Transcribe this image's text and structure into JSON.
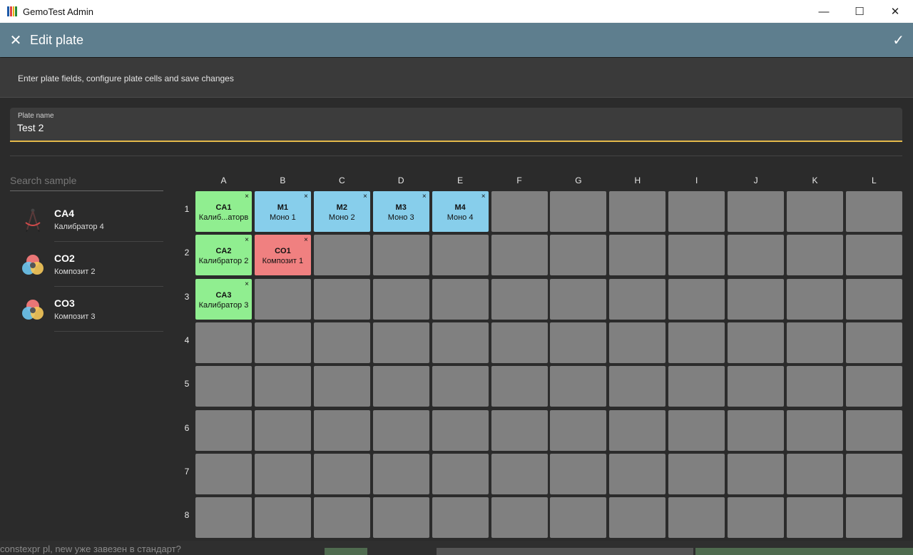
{
  "window": {
    "title": "GemoTest Admin"
  },
  "appbar": {
    "title": "Edit plate"
  },
  "subheader": {
    "description": "Enter plate fields, configure plate cells and save changes"
  },
  "plate_name": {
    "label": "Plate name",
    "value": "Test 2"
  },
  "search": {
    "placeholder": "Search sample"
  },
  "samples": [
    {
      "code": "CA4",
      "name": "Калибратор 4",
      "icon": "calibrator-compass-icon"
    },
    {
      "code": "CO2",
      "name": "Композит 2",
      "icon": "composite-venn-icon"
    },
    {
      "code": "CO3",
      "name": "Композит 3",
      "icon": "composite-venn-icon"
    }
  ],
  "grid": {
    "columns": [
      "A",
      "B",
      "C",
      "D",
      "E",
      "F",
      "G",
      "H",
      "I",
      "J",
      "K",
      "L"
    ],
    "rows": [
      "1",
      "2",
      "3",
      "4",
      "5",
      "6",
      "7",
      "8"
    ],
    "filled": [
      {
        "row": 0,
        "col": 0,
        "code": "CA1",
        "name": "Калиб...аторв",
        "color": "#90ee90"
      },
      {
        "row": 0,
        "col": 1,
        "code": "M1",
        "name": "Моно 1",
        "color": "#87ceeb"
      },
      {
        "row": 0,
        "col": 2,
        "code": "M2",
        "name": "Моно 2",
        "color": "#87ceeb"
      },
      {
        "row": 0,
        "col": 3,
        "code": "M3",
        "name": "Моно 3",
        "color": "#87ceeb"
      },
      {
        "row": 0,
        "col": 4,
        "code": "M4",
        "name": "Моно 4",
        "color": "#87ceeb"
      },
      {
        "row": 1,
        "col": 0,
        "code": "CA2",
        "name": "Калибратор 2",
        "color": "#90ee90"
      },
      {
        "row": 1,
        "col": 1,
        "code": "CO1",
        "name": "Композит 1",
        "color": "#f08080"
      },
      {
        "row": 2,
        "col": 0,
        "code": "CA3",
        "name": "Калибратор 3",
        "color": "#90ee90"
      }
    ],
    "remove_glyph": "×"
  },
  "background_text": "constexpr pl, new уже завезен в стандарт?"
}
